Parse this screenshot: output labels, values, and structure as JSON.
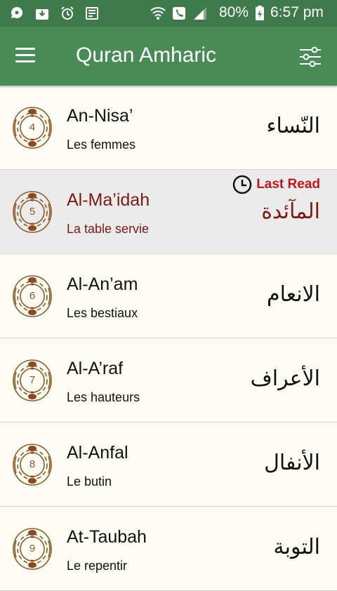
{
  "status_bar": {
    "battery": "80%",
    "time": "6:57 pm"
  },
  "app_bar": {
    "title": "Quran Amharic"
  },
  "surahs": [
    {
      "number": "4",
      "name": "An-Nisa’",
      "translation": "Les femmes",
      "arabic": "النّساء"
    },
    {
      "number": "5",
      "name": "Al-Ma’idah",
      "translation": "La table servie",
      "arabic": "المآئدة",
      "last_read": "Last Read"
    },
    {
      "number": "6",
      "name": "Al-An’am",
      "translation": "Les bestiaux",
      "arabic": "الانعام"
    },
    {
      "number": "7",
      "name": "Al-A’raf",
      "translation": "Les hauteurs",
      "arabic": "الأعراف"
    },
    {
      "number": "8",
      "name": "Al-Anfal",
      "translation": "Le butin",
      "arabic": "الأنفال"
    },
    {
      "number": "9",
      "name": "At-Taubah",
      "translation": "Le repentir",
      "arabic": "التوبة"
    }
  ]
}
